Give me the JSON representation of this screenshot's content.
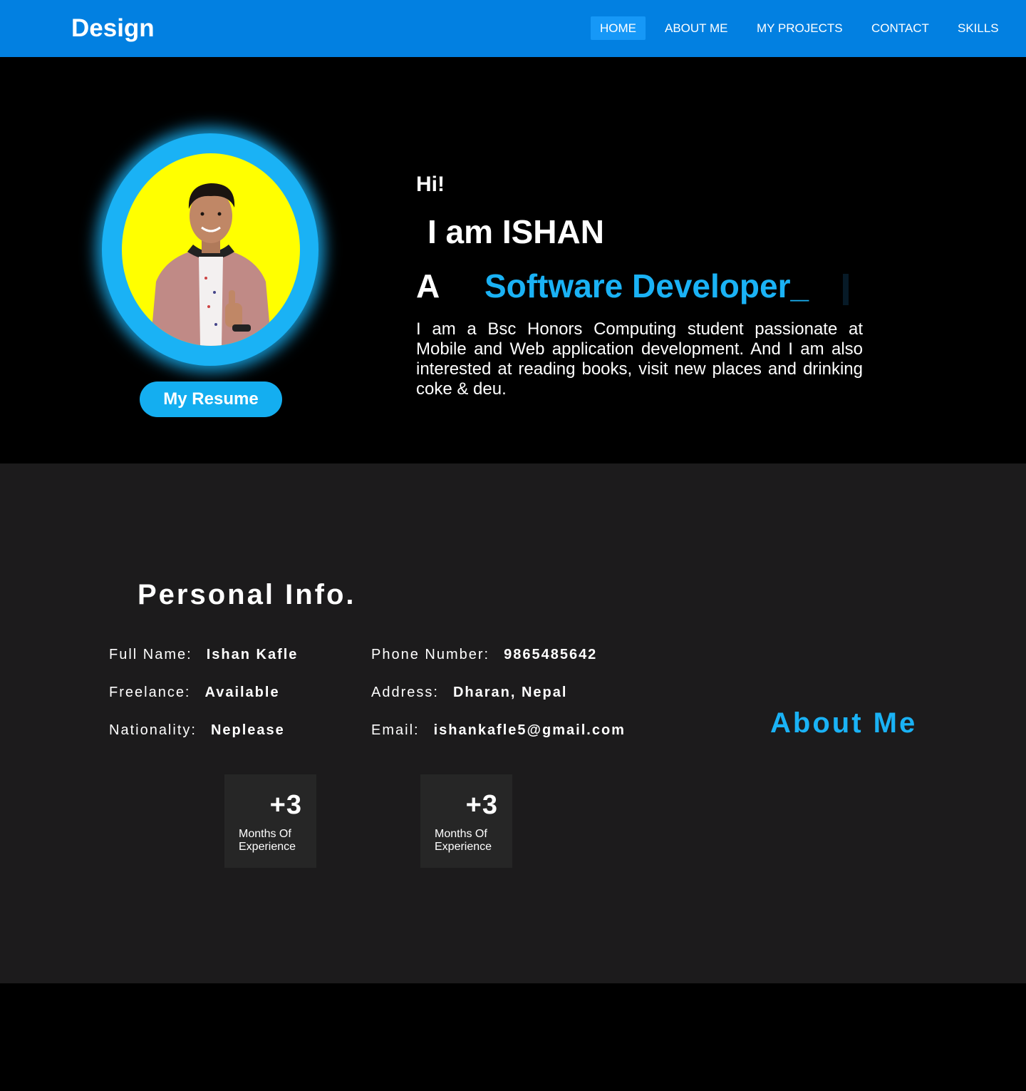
{
  "nav": {
    "brand": "Design",
    "links": [
      "HOME",
      "ABOUT ME",
      "MY PROJECTS",
      "CONTACT",
      "SKILLS"
    ]
  },
  "hero": {
    "greeting": "Hi!",
    "intro": "I am ISHAN",
    "role_prefix": "A",
    "role": "Software Developer_",
    "bio": "I am a Bsc Honors Computing student passionate at Mobile and Web application development. And I am also interested at reading books, visit new places and drinking coke & deu.",
    "resume_label": "My Resume"
  },
  "info": {
    "title": "Personal Info.",
    "left": [
      {
        "label": "Full Name:",
        "value": "Ishan Kafle"
      },
      {
        "label": "Freelance:",
        "value": "Available"
      },
      {
        "label": "Nationality:",
        "value": "Neplease"
      }
    ],
    "right": [
      {
        "label": "Phone Number:",
        "value": "9865485642"
      },
      {
        "label": "Address:",
        "value": "Dharan, Nepal"
      },
      {
        "label": "Email:",
        "value": "ishankafle5@gmail.com"
      }
    ],
    "stats": [
      {
        "number": "+3",
        "caption": "Months Of Experience"
      },
      {
        "number": "+3",
        "caption": "Months Of Experience"
      }
    ],
    "about_title": "About Me"
  },
  "colors": {
    "nav_bg": "#0280e1",
    "accent": "#1ab2f5",
    "avatar_bg": "#ffff00",
    "info_bg": "#1c1b1c"
  }
}
